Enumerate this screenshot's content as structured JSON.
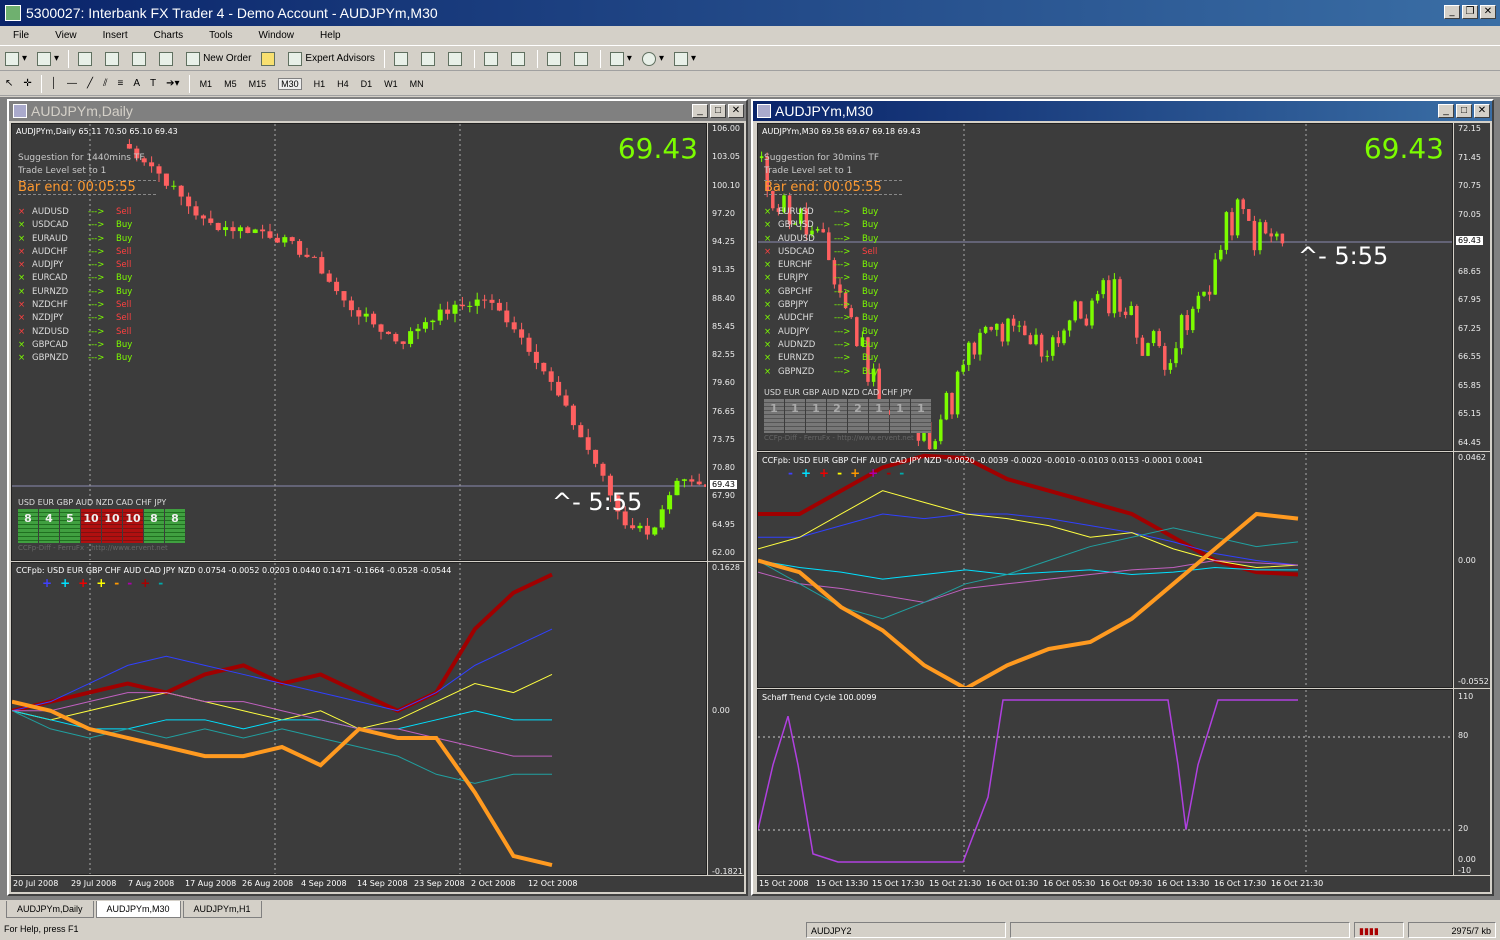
{
  "window": {
    "title": "5300027: Interbank FX Trader 4 - Demo Account - AUDJPYm,M30"
  },
  "menu": [
    "File",
    "View",
    "Insert",
    "Charts",
    "Tools",
    "Window",
    "Help"
  ],
  "toolbar": {
    "new_order": "New Order",
    "expert_advisors": "Expert Advisors"
  },
  "timeframes": [
    "M1",
    "M5",
    "M15",
    "M30",
    "H1",
    "H4",
    "D1",
    "W1",
    "MN"
  ],
  "active_timeframe": "M30",
  "left_window": {
    "title": "AUDJPYm,Daily",
    "header": "AUDJPYm,Daily  65.11 70.50 65.10 69.43",
    "big_price": "69.43",
    "countdown": "^- 5:55",
    "suggestion": "Suggestion for 1440mins TF",
    "trade_level": "Trade Level set to 1",
    "bar_end": "Bar end: 00:05:55",
    "pairs": [
      {
        "pair": "AUDUSD",
        "arrow": "--->",
        "action": "Sell"
      },
      {
        "pair": "USDCAD",
        "arrow": "--->",
        "action": "Buy"
      },
      {
        "pair": "EURAUD",
        "arrow": "--->",
        "action": "Buy"
      },
      {
        "pair": "AUDCHF",
        "arrow": "--->",
        "action": "Sell"
      },
      {
        "pair": "AUDJPY",
        "arrow": "--->",
        "action": "Sell"
      },
      {
        "pair": "EURCAD",
        "arrow": "--->",
        "action": "Buy"
      },
      {
        "pair": "EURNZD",
        "arrow": "--->",
        "action": "Buy"
      },
      {
        "pair": "NZDCHF",
        "arrow": "--->",
        "action": "Sell"
      },
      {
        "pair": "NZDJPY",
        "arrow": "--->",
        "action": "Sell"
      },
      {
        "pair": "NZDUSD",
        "arrow": "--->",
        "action": "Sell"
      },
      {
        "pair": "GBPCAD",
        "arrow": "--->",
        "action": "Buy"
      },
      {
        "pair": "GBPNZD",
        "arrow": "--->",
        "action": "Buy"
      }
    ],
    "currency_meter": {
      "labels": "USD  EUR  GBP  AUD  NZD  CAD  CHF  JPY",
      "values": [
        "8",
        "4",
        "5",
        "10",
        "10",
        "10",
        "8",
        "8"
      ],
      "footer": "CCFp-Diff - FerruFx - http://www.ervent.net"
    },
    "price_axis": [
      "106.00",
      "103.05",
      "100.10",
      "97.20",
      "94.25",
      "91.35",
      "88.40",
      "85.45",
      "82.55",
      "79.60",
      "76.65",
      "73.75",
      "70.80",
      "67.90",
      "64.95",
      "62.00"
    ],
    "price_tag": "69.43",
    "ccf_header": "CCFpb: USD EUR GBP CHF AUD CAD JPY NZD  0.0754 -0.0052 0.0203 0.0440 0.1471 -0.1664 -0.0528 -0.0544",
    "ccf_axis": [
      "0.1628",
      "0.00",
      "-0.1821"
    ],
    "dates": [
      "20 Jul 2008",
      "29 Jul 2008",
      "7 Aug 2008",
      "17 Aug 2008",
      "26 Aug 2008",
      "4 Sep 2008",
      "14 Sep 2008",
      "23 Sep 2008",
      "2 Oct 2008",
      "12 Oct 2008"
    ]
  },
  "right_window": {
    "title": "AUDJPYm,M30",
    "header": "AUDJPYm,M30  69.58 69.67 69.18 69.43",
    "big_price": "69.43",
    "countdown": "^- 5:55",
    "suggestion": "Suggestion for 30mins TF",
    "trade_level": "Trade Level set to 1",
    "bar_end": "Bar end: 00:05:55",
    "pairs": [
      {
        "pair": "EURUSD",
        "arrow": "--->",
        "action": "Buy"
      },
      {
        "pair": "GBPUSD",
        "arrow": "--->",
        "action": "Buy"
      },
      {
        "pair": "AUDUSD",
        "arrow": "--->",
        "action": "Buy"
      },
      {
        "pair": "USDCAD",
        "arrow": "--->",
        "action": "Sell"
      },
      {
        "pair": "EURCHF",
        "arrow": "--->",
        "action": "Buy"
      },
      {
        "pair": "EURJPY",
        "arrow": "--->",
        "action": "Buy"
      },
      {
        "pair": "GBPCHF",
        "arrow": "--->",
        "action": "Buy"
      },
      {
        "pair": "GBPJPY",
        "arrow": "--->",
        "action": "Buy"
      },
      {
        "pair": "AUDCHF",
        "arrow": "--->",
        "action": "Buy"
      },
      {
        "pair": "AUDJPY",
        "arrow": "--->",
        "action": "Buy"
      },
      {
        "pair": "AUDNZD",
        "arrow": "--->",
        "action": "Buy"
      },
      {
        "pair": "EURNZD",
        "arrow": "--->",
        "action": "Buy"
      },
      {
        "pair": "GBPNZD",
        "arrow": "--->",
        "action": "Buy"
      }
    ],
    "currency_meter": {
      "labels": "USD  EUR  GBP  AUD  NZD  CAD  CHF  JPY",
      "values": [
        "1",
        "1",
        "1",
        "2",
        "2",
        "1",
        "1",
        "1"
      ],
      "footer": "CCFp-Diff - FerruFx - http://www.ervent.net"
    },
    "price_axis": [
      "72.15",
      "71.45",
      "70.75",
      "70.05",
      "69.35",
      "68.65",
      "67.95",
      "67.25",
      "66.55",
      "65.85",
      "65.15",
      "64.45"
    ],
    "price_tag": "69.43",
    "ccf_header": "CCFpb: USD EUR GBP CHF AUD CAD JPY NZD  -0.0020 -0.0039 -0.0020 -0.0010 -0.0103 0.0153 -0.0001 0.0041",
    "ccf_axis": [
      "0.0462",
      "0.00",
      "-0.0552"
    ],
    "stc_header": "Schaff Trend Cycle 100.0099",
    "stc_axis": [
      "110",
      "80",
      "20",
      "0.00",
      "-10"
    ],
    "dates": [
      "15 Oct 2008",
      "15 Oct 13:30",
      "15 Oct 17:30",
      "15 Oct 21:30",
      "16 Oct 01:30",
      "16 Oct 05:30",
      "16 Oct 09:30",
      "16 Oct 13:30",
      "16 Oct 17:30",
      "16 Oct 21:30"
    ]
  },
  "tabs": [
    "AUDJPYm,Daily",
    "AUDJPYm,M30",
    "AUDJPYm,H1"
  ],
  "active_tab": "AUDJPYm,M30",
  "status": {
    "help": "For Help, press F1",
    "symbol": "AUDJPY2",
    "traffic": "2975/7 kb"
  },
  "colors": {
    "chart_bg": "#3c3c3c",
    "bull": "#7cfc00",
    "bear": "#ff6060",
    "price": "#7cfc00",
    "countdown": "#ffffff",
    "bar_end": "#ff9a30",
    "stc": "#b040e0"
  }
}
